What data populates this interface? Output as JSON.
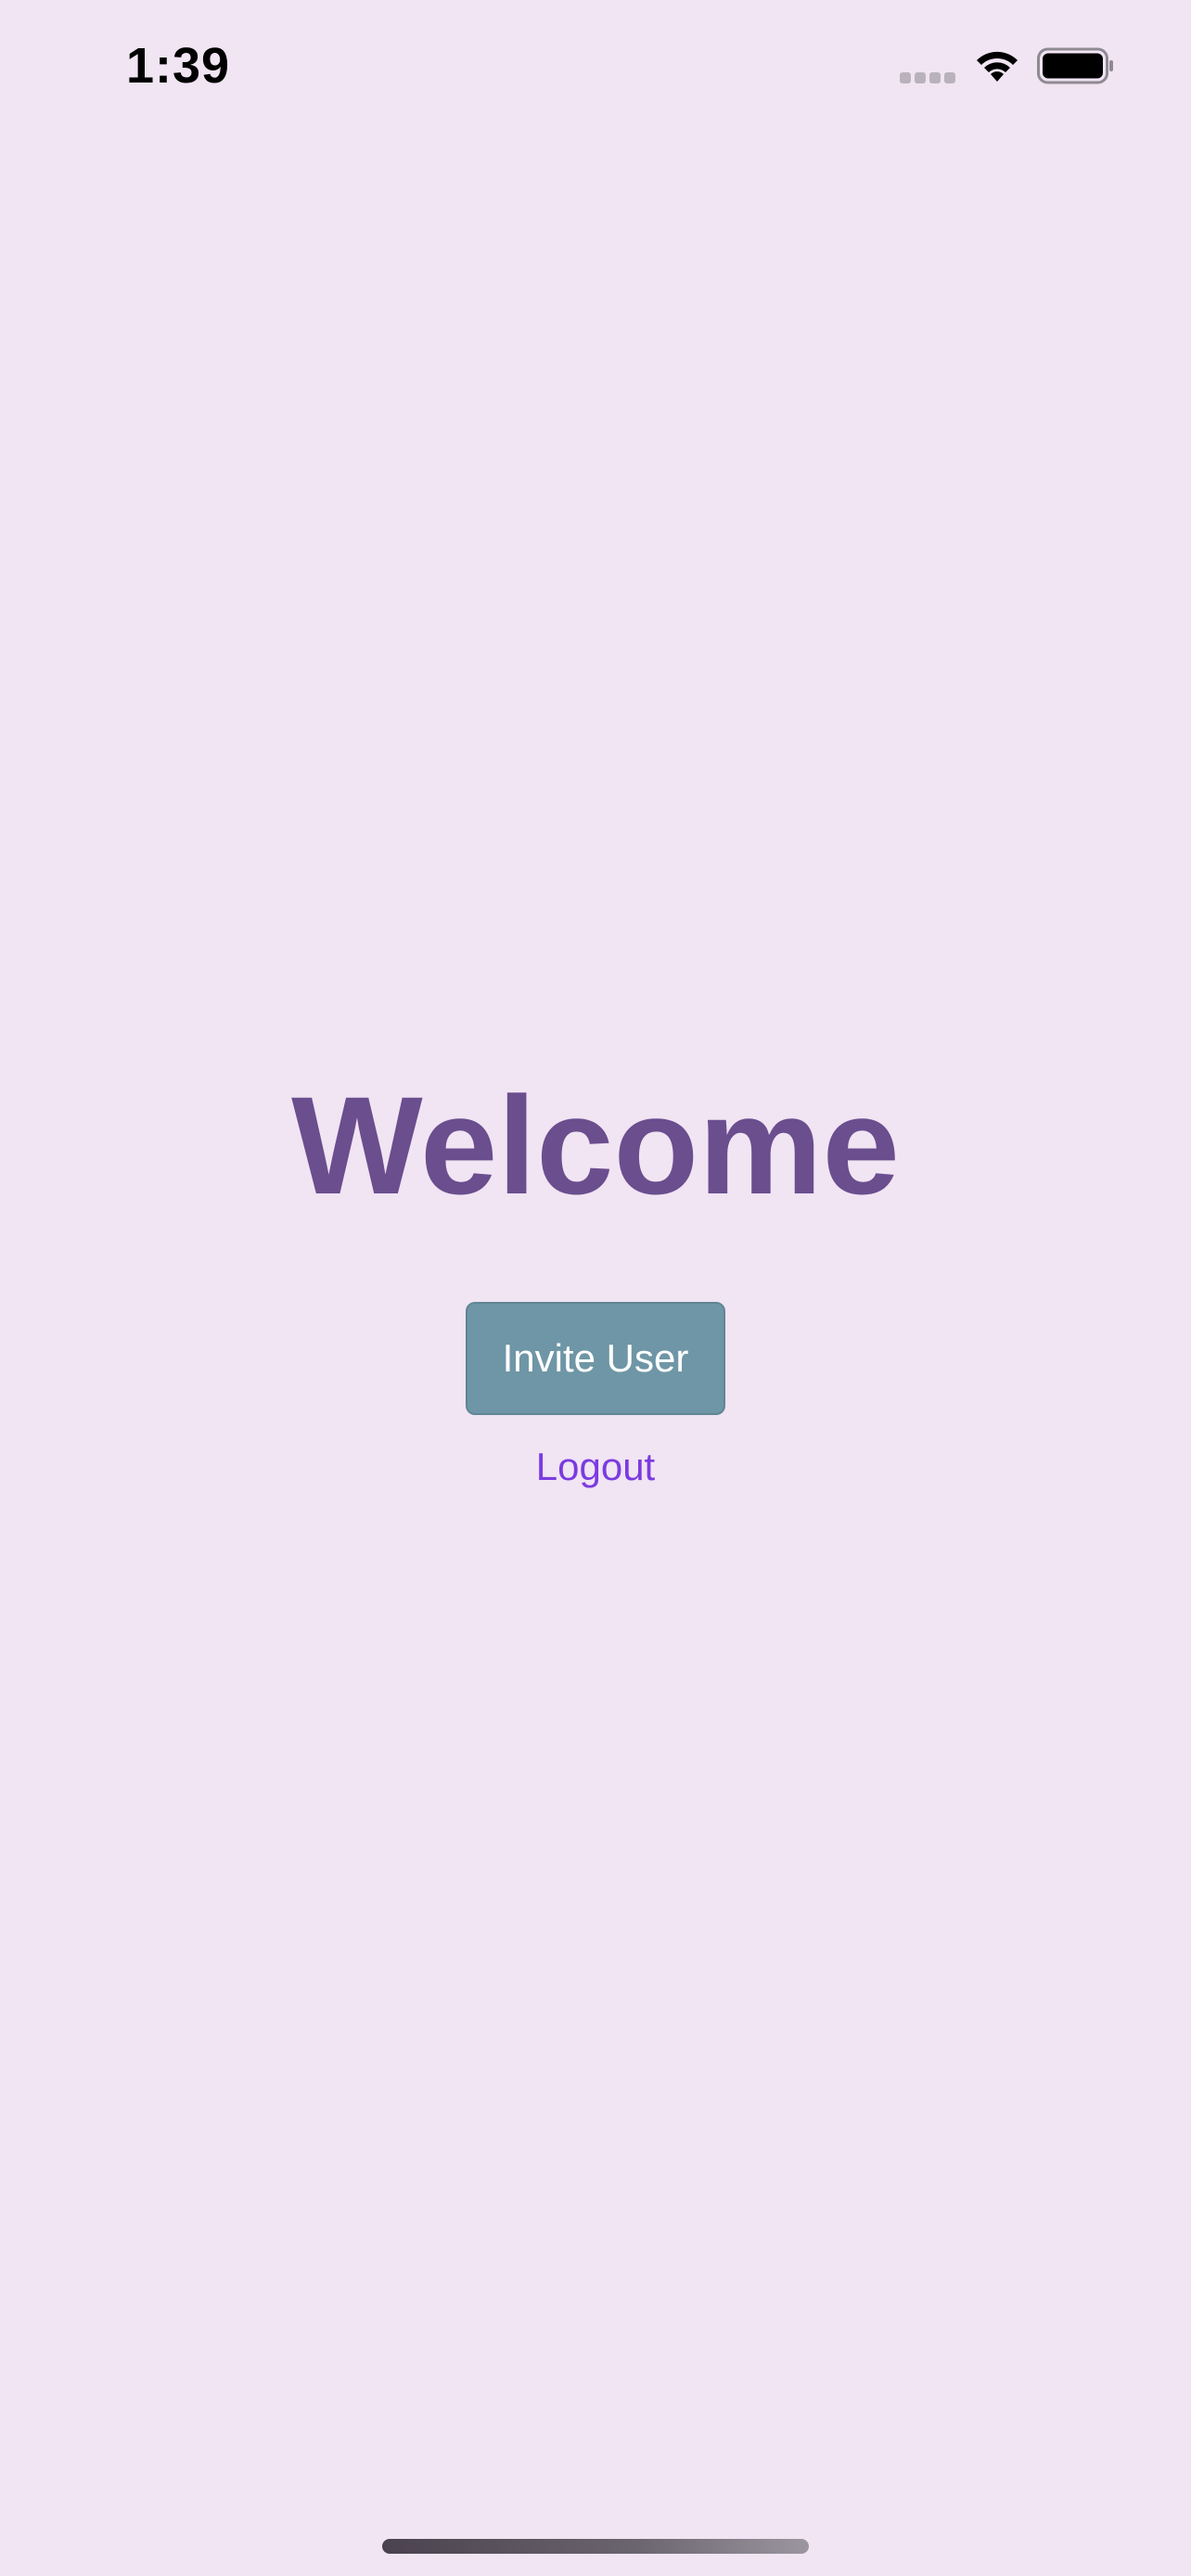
{
  "status_bar": {
    "time": "1:39",
    "signal_icon": "cellular-signal-icon",
    "wifi_icon": "wifi-icon",
    "battery_icon": "battery-icon"
  },
  "main": {
    "title": "Welcome",
    "invite_button_label": "Invite User",
    "logout_label": "Logout"
  },
  "colors": {
    "background": "#F1E4F3",
    "title": "#6A4E8E",
    "button": "#6F96A6",
    "link": "#7B3BE0"
  }
}
